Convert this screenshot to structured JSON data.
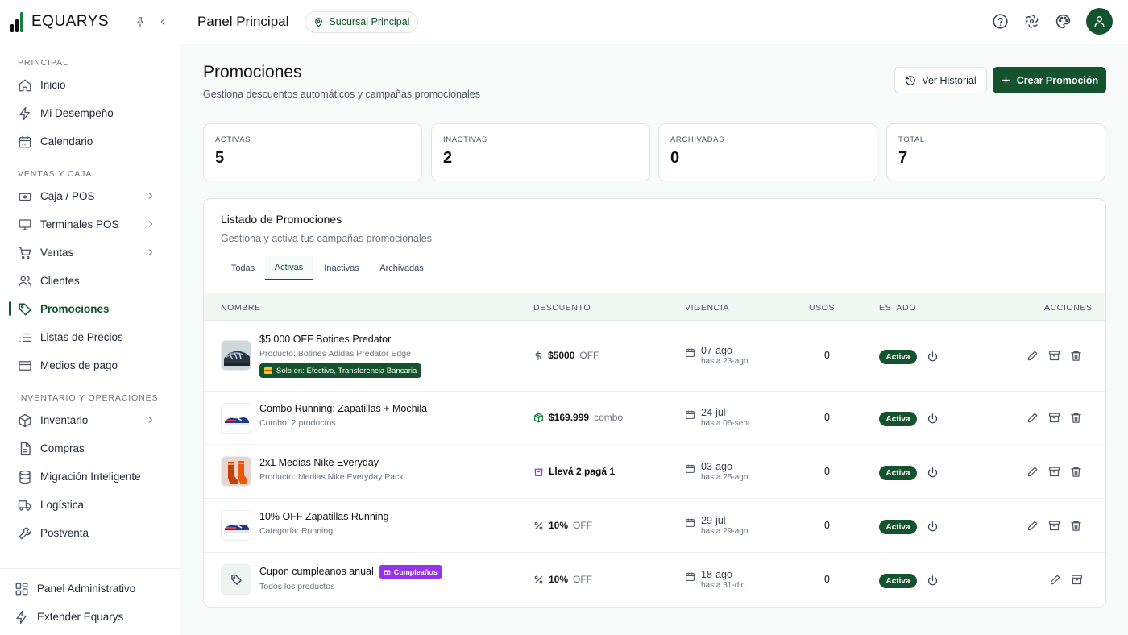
{
  "brand": {
    "name": "EQUARYS",
    "accent": "#14532d"
  },
  "sidebar": {
    "sections": [
      {
        "title": "PRINCIPAL",
        "items": [
          {
            "label": "Inicio",
            "icon": "home-icon"
          },
          {
            "label": "Mi Desempeño",
            "icon": "lightning-icon"
          },
          {
            "label": "Calendario",
            "icon": "calendar-icon"
          }
        ]
      },
      {
        "title": "VENTAS Y CAJA",
        "items": [
          {
            "label": "Caja / POS",
            "icon": "cash-register-icon"
          },
          {
            "label": "Terminales POS",
            "icon": "monitor-icon"
          },
          {
            "label": "Ventas",
            "icon": "cart-icon"
          },
          {
            "label": "Clientes",
            "icon": "users-icon"
          },
          {
            "label": "Promociones",
            "icon": "tag-icon"
          },
          {
            "label": "Listas de Precios",
            "icon": "list-icon"
          },
          {
            "label": "Medios de pago",
            "icon": "credit-card-icon"
          }
        ]
      },
      {
        "title": "INVENTARIO Y OPERACIONES",
        "items": [
          {
            "label": "Inventario",
            "icon": "box-icon"
          },
          {
            "label": "Compras",
            "icon": "document-icon"
          },
          {
            "label": "Migración Inteligente",
            "icon": "database-icon"
          },
          {
            "label": "Logística",
            "icon": "truck-icon"
          },
          {
            "label": "Postventa",
            "icon": "wrench-icon"
          }
        ]
      }
    ],
    "bottom": [
      {
        "label": "Panel Administrativo",
        "icon": "grid-icon"
      },
      {
        "label": "Extender Equarys",
        "icon": "lightning-icon"
      }
    ]
  },
  "topbar": {
    "title": "Panel Principal",
    "branch": "Sucursal Principal"
  },
  "page": {
    "title": "Promociones",
    "subtitle": "Gestiona descuentos automáticos y campañas promocionales",
    "history_button": "Ver Historial",
    "create_button": "Crear Promoción"
  },
  "stats": [
    {
      "label": "ACTIVAS",
      "value": "5"
    },
    {
      "label": "INACTIVAS",
      "value": "2"
    },
    {
      "label": "ARCHIVADAS",
      "value": "0"
    },
    {
      "label": "TOTAL",
      "value": "7"
    }
  ],
  "list": {
    "title": "Listado de Promociones",
    "subtitle": "Gestiona y activa tus campañas promocionales",
    "tabs": [
      "Todas",
      "Activas",
      "Inactivas",
      "Archivadas"
    ],
    "active_tab": "Activas",
    "columns": [
      "NOMBRE",
      "DESCUENTO",
      "VIGENCIA",
      "USOS",
      "ESTADO",
      "ACCIONES"
    ],
    "rows": [
      {
        "name": "$5.000 OFF Botines Predator",
        "detail": "Producto: Botines Adidas Predator Edge",
        "payment_badge": "Solo en: Efectivo, Transferencia Bancaria",
        "discount_icon": "dollar-icon",
        "discount_value": "$5000",
        "discount_unit": "OFF",
        "date_from": "07-ago",
        "date_to": "hasta 23-ago",
        "uses": "0",
        "status": "Activa"
      },
      {
        "name": "Combo Running: Zapatillas + Mochila",
        "detail": "Combo: 2 productos",
        "discount_icon": "package-icon",
        "discount_value": "$169.999",
        "discount_unit": "combo",
        "date_from": "24-jul",
        "date_to": "hasta 06-sept",
        "uses": "0",
        "status": "Activa"
      },
      {
        "name": "2x1 Medias Nike Everyday",
        "detail": "Producto: Medias Nike Everyday Pack",
        "discount_icon": "shopping-bag-icon",
        "discount_value": "Llevá 2 pagá 1",
        "discount_unit": "",
        "date_from": "03-ago",
        "date_to": "hasta 25-ago",
        "uses": "0",
        "status": "Activa"
      },
      {
        "name": "10% OFF Zapatillas Running",
        "detail": "Categoría: Running",
        "discount_icon": "percent-icon",
        "discount_value": "10%",
        "discount_unit": "OFF",
        "date_from": "29-jul",
        "date_to": "hasta 29-ago",
        "uses": "0",
        "status": "Activa"
      },
      {
        "name": "Cupon cumpleanos anual",
        "badge": "Cumpleaños",
        "detail": "Todos los productos",
        "discount_icon": "percent-icon",
        "discount_value": "10%",
        "discount_unit": "OFF",
        "date_from": "18-ago",
        "date_to": "hasta 31-dic",
        "uses": "0",
        "status": "Activa"
      }
    ]
  }
}
